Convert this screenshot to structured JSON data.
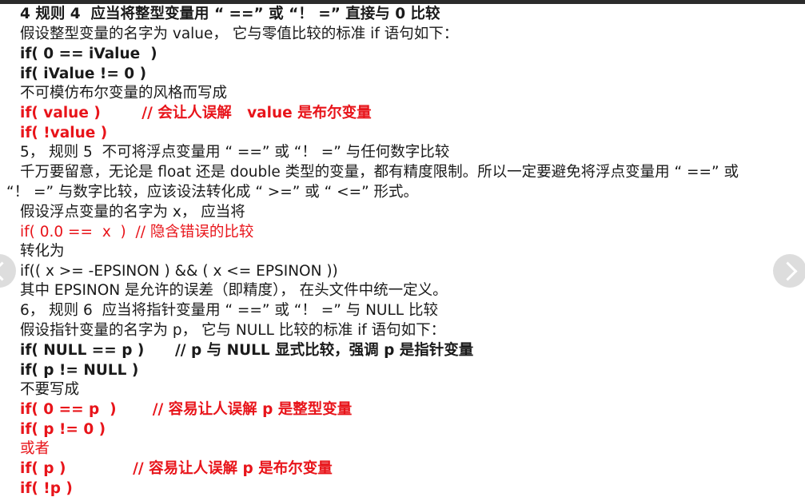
{
  "lines": [
    "4 规则 4  应当将整型变量用 “ ==” 或 “！ =” 直接与 0 比较",
    "假设整型变量的名字为 value， 它与零值比较的标准 if 语句如下：",
    "if( 0 == iValue  )",
    "if( iValue != 0 )",
    "不可模仿布尔变量的风格而写成",
    "if( value )        // 会让人误解   value 是布尔变量",
    "if( !value )",
    "5， 规则 5  不可将浮点变量用 “ ==” 或 “！ =” 与任何数字比较",
    "千万要留意，无论是 float 还是 double 类型的变量，都有精度限制。所以一定要避免将浮点变量用 “ ==” 或",
    "“！ =” 与数字比较，应该设法转化成 “ >=” 或 “ <=” 形式。",
    "假设浮点变量的名字为 x， 应当将",
    "if( 0.0 ==  x  )  // 隐含错误的比较",
    "转化为",
    "if(( x >= -EPSINON ) && ( x <= EPSINON ))",
    "其中 EPSINON 是允许的误差（即精度）， 在头文件中统一定义。",
    "6， 规则 6  应当将指针变量用 “ ==” 或 “！ =” 与 NULL 比较",
    "假设指针变量的名字为 p， 它与 NULL 比较的标准 if 语句如下：",
    "if( NULL == p )      // p 与 NULL 显式比较，强调 p 是指针变量",
    "if( p != NULL )",
    "不要写成",
    "if( 0 == p  )       // 容易让人误解 p 是整型变量",
    "if( p != 0 )",
    "或者",
    "if( p )             // 容易让人误解 p 是布尔变量",
    "if( !p )"
  ],
  "nav": {
    "prev_icon": "chevron-left-icon",
    "next_icon": "chevron-right-icon"
  },
  "colors": {
    "text": "#1a1a1a",
    "highlight": "#e8141a",
    "nav_button": "#d7d7d7"
  }
}
